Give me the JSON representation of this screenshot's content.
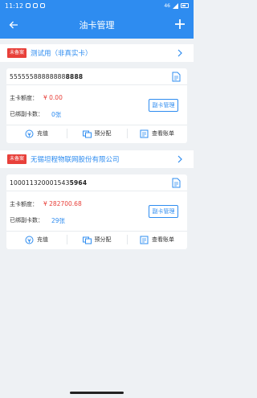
{
  "status_bar": {
    "time": "11:12",
    "network": "46"
  },
  "header": {
    "title": "油卡管理"
  },
  "groups": [
    {
      "tag": "未备案",
      "name": "测试用（非真实卡）",
      "card": {
        "number_prefix": "55555588888888",
        "number_suffix": "8888",
        "limit_label": "主卡额度：",
        "limit_value": "¥ 0.00",
        "bound_label": "已绑副卡数：",
        "bound_value": "0张",
        "sub_card_button": "副卡管理",
        "actions": [
          "充值",
          "预分配",
          "查看账单"
        ]
      }
    },
    {
      "tag": "未备案",
      "name": "无锡坦程物联网股份有限公司",
      "card": {
        "number_prefix": "100011320001543",
        "number_suffix": "5964",
        "limit_label": "主卡额度：",
        "limit_value": "¥ 282700.68",
        "bound_label": "已绑副卡数：",
        "bound_value": "29张",
        "sub_card_button": "副卡管理",
        "actions": [
          "充值",
          "预分配",
          "查看账单"
        ]
      }
    }
  ],
  "icons": {
    "back": "back-arrow-icon",
    "add": "plus-icon",
    "chevron": "chevron-right-icon",
    "doc": "document-icon",
    "recharge": "recharge-icon",
    "preallocate": "preallocate-icon",
    "bill": "bill-icon"
  },
  "colors": {
    "primary": "#2e8cf0",
    "tag_red": "#e8403a",
    "background": "#eef1f4"
  }
}
